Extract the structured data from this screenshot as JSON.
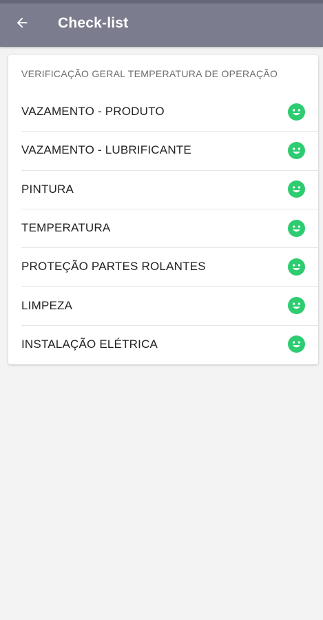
{
  "app_bar": {
    "title": "Check-list",
    "back_icon": "arrow-left-icon",
    "background": "#7b7c8d"
  },
  "card": {
    "header": "VERIFICAÇÃO GERAL TEMPERATURA DE OPERAÇÃO",
    "items": [
      {
        "label": "VAZAMENTO - PRODUTO",
        "status_icon": "smile-icon",
        "status_color": "#2ecc71"
      },
      {
        "label": "VAZAMENTO - LUBRIFICANTE",
        "status_icon": "smile-icon",
        "status_color": "#2ecc71"
      },
      {
        "label": "PINTURA",
        "status_icon": "smile-icon",
        "status_color": "#2ecc71"
      },
      {
        "label": "TEMPERATURA",
        "status_icon": "smile-icon",
        "status_color": "#2ecc71"
      },
      {
        "label": "PROTEÇÃO PARTES ROLANTES",
        "status_icon": "smile-icon",
        "status_color": "#2ecc71"
      },
      {
        "label": "LIMPEZA",
        "status_icon": "smile-icon",
        "status_color": "#2ecc71"
      },
      {
        "label": "INSTALAÇÃO ELÉTRICA",
        "status_icon": "smile-icon",
        "status_color": "#2ecc71"
      }
    ]
  }
}
